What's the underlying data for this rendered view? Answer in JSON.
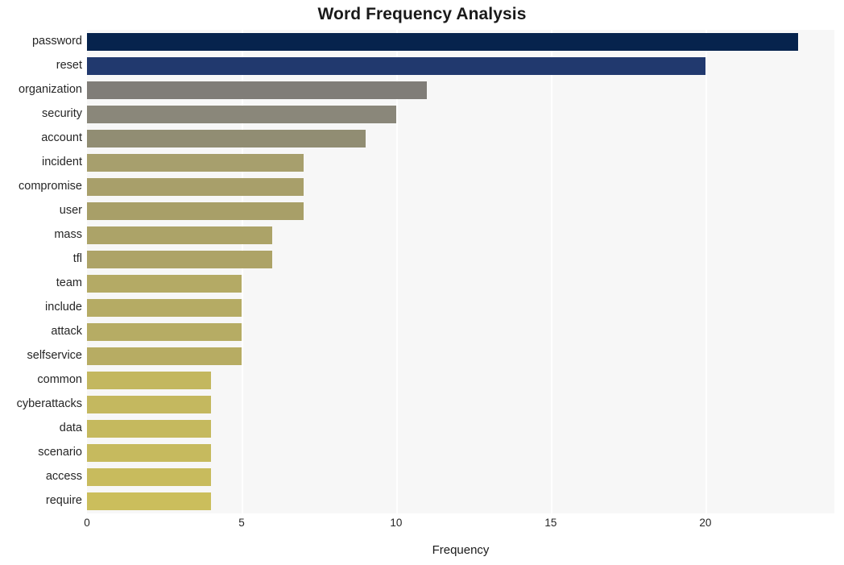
{
  "chart_data": {
    "type": "bar",
    "orientation": "horizontal",
    "title": "Word Frequency Analysis",
    "xlabel": "Frequency",
    "ylabel": "",
    "categories": [
      "password",
      "reset",
      "organization",
      "security",
      "account",
      "incident",
      "compromise",
      "user",
      "mass",
      "tfl",
      "team",
      "include",
      "attack",
      "selfservice",
      "common",
      "cyberattacks",
      "data",
      "scenario",
      "access",
      "require"
    ],
    "values": [
      23,
      20,
      11,
      10,
      9,
      7,
      7,
      7,
      6,
      6,
      5,
      5,
      5,
      5,
      4,
      4,
      4,
      4,
      4,
      4
    ],
    "bar_colors": [
      "#06234d",
      "#21396e",
      "#807d78",
      "#8a877a",
      "#918d73",
      "#a79f6d",
      "#a89f6a",
      "#a89f68",
      "#aca368",
      "#ada367",
      "#b4aa65",
      "#b5ab64",
      "#b6ac64",
      "#b7ac63",
      "#c3b75f",
      "#c4b85f",
      "#c5b95e",
      "#c6ba5e",
      "#c8bb5d",
      "#cbbe5c"
    ],
    "xlim": [
      0,
      24.17
    ],
    "xticks": [
      0,
      5,
      10,
      15,
      20
    ],
    "xtick_labels": [
      "0",
      "5",
      "10",
      "15",
      "20"
    ],
    "grid": "vertical",
    "gridline_color": "#ffffff",
    "plot_background": "#f7f7f7",
    "figure_background": "#ffffff",
    "legend": null
  }
}
